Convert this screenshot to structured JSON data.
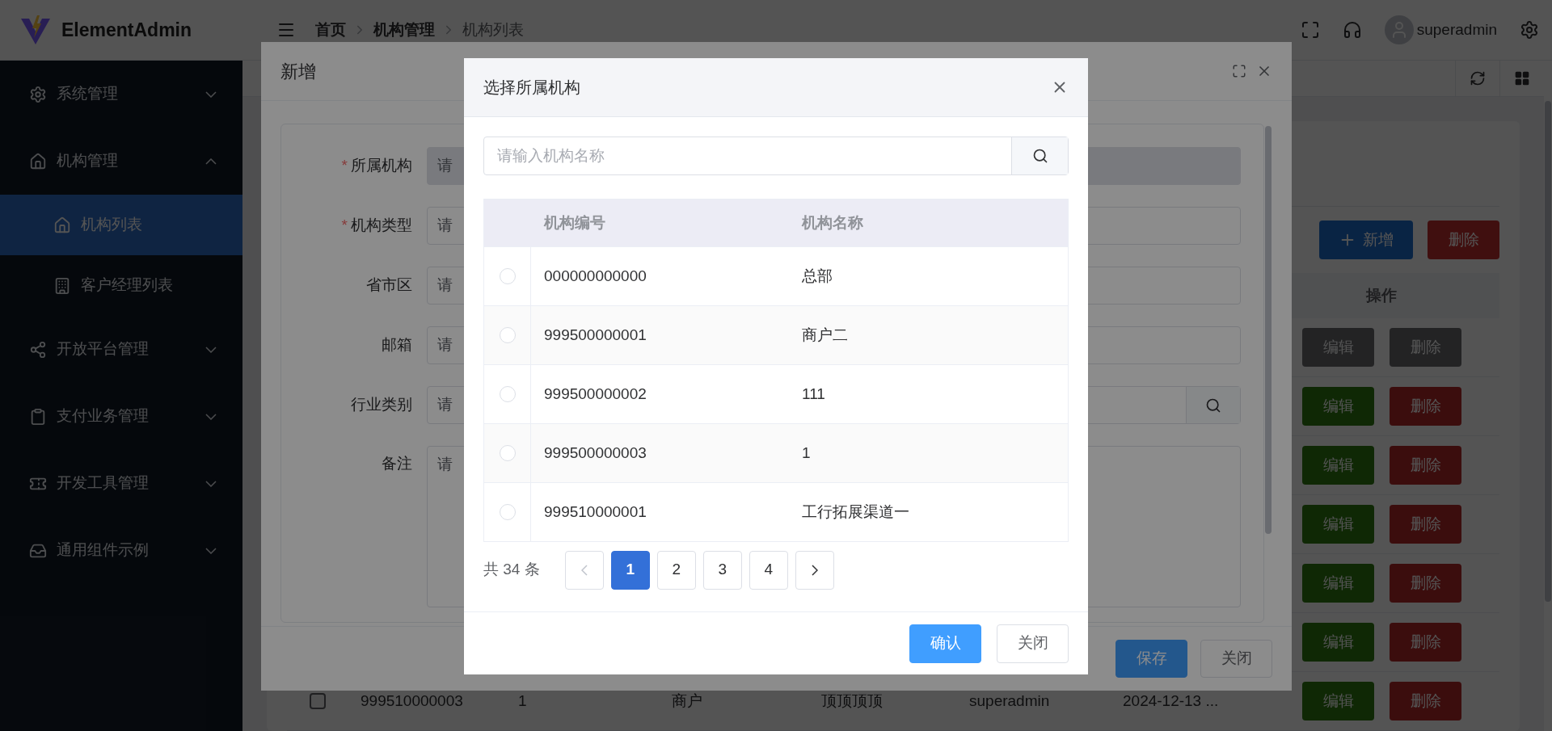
{
  "header": {
    "logo": "ElementAdmin",
    "breadcrumb": [
      {
        "label": "首页",
        "current": false
      },
      {
        "label": "机构管理",
        "current": false
      },
      {
        "label": "机构列表",
        "current": true
      }
    ],
    "user": "superadmin"
  },
  "sidebar": {
    "items": [
      {
        "label": "系统管理",
        "expanded": false
      },
      {
        "label": "机构管理",
        "expanded": true,
        "children": [
          {
            "label": "机构列表",
            "selected": true
          },
          {
            "label": "客户经理列表",
            "selected": false
          }
        ]
      },
      {
        "label": "开放平台管理",
        "expanded": false
      },
      {
        "label": "支付业务管理",
        "expanded": false
      },
      {
        "label": "开发工具管理",
        "expanded": false
      },
      {
        "label": "通用组件示例",
        "expanded": false
      }
    ]
  },
  "page": {
    "toolbar": {
      "add": "新增",
      "delete": "删除"
    },
    "ops_header": "操作",
    "rows": [
      {
        "disabled": true,
        "edit": "编辑",
        "delete": "删除"
      },
      {
        "disabled": false,
        "edit": "编辑",
        "delete": "删除"
      },
      {
        "disabled": false,
        "edit": "编辑",
        "delete": "删除"
      },
      {
        "disabled": false,
        "edit": "编辑",
        "delete": "删除"
      },
      {
        "disabled": false,
        "edit": "编辑",
        "delete": "删除"
      },
      {
        "disabled": false,
        "edit": "编辑",
        "delete": "删除"
      },
      {
        "disabled": false,
        "edit": "编辑",
        "delete": "删除",
        "checked": false,
        "cells": [
          "999510000003",
          "1",
          "商户",
          "顶顶顶顶",
          "superadmin",
          "2024-12-13 ..."
        ]
      }
    ]
  },
  "dialog": {
    "title": "新增",
    "fields": [
      {
        "label": "所属机构",
        "required_mark": "*",
        "kind": "select",
        "disabled": true,
        "placeholder": "请"
      },
      {
        "label": "机构类型",
        "required_mark": "*",
        "kind": "select",
        "disabled": false,
        "placeholder": "请"
      },
      {
        "label": "省市区",
        "kind": "select",
        "disabled": false,
        "placeholder": "请"
      },
      {
        "label": "邮箱",
        "kind": "input",
        "disabled": false,
        "placeholder": "请"
      },
      {
        "label": "行业类别",
        "kind": "search",
        "disabled": false,
        "placeholder": "请"
      },
      {
        "label": "备注",
        "kind": "textarea",
        "disabled": false,
        "placeholder": "请"
      }
    ],
    "buttons": [
      {
        "label": "保存",
        "kind": "primary"
      },
      {
        "label": "关闭",
        "kind": "default"
      }
    ]
  },
  "picker": {
    "title": "选择所属机构",
    "search": {
      "placeholder": "请输入机构名称"
    },
    "columns": [
      "机构编号",
      "机构名称"
    ],
    "rows": [
      {
        "cells": [
          "000000000000",
          "总部"
        ],
        "selected": false
      },
      {
        "cells": [
          "999500000001",
          "商户二"
        ],
        "selected": false
      },
      {
        "cells": [
          "999500000002",
          "111"
        ],
        "selected": false
      },
      {
        "cells": [
          "999500000003",
          "1"
        ],
        "selected": false
      },
      {
        "cells": [
          "999510000001",
          "工行拓展渠道一"
        ],
        "selected": false
      }
    ],
    "pagination": {
      "total": "共 34 条",
      "pages": [
        {
          "label": "1",
          "selected": true
        },
        {
          "label": "2",
          "selected": false
        },
        {
          "label": "3",
          "selected": false
        },
        {
          "label": "4",
          "selected": false
        }
      ]
    },
    "buttons": [
      {
        "label": "确认",
        "kind": "primary"
      },
      {
        "label": "关闭",
        "kind": "default"
      }
    ]
  }
}
